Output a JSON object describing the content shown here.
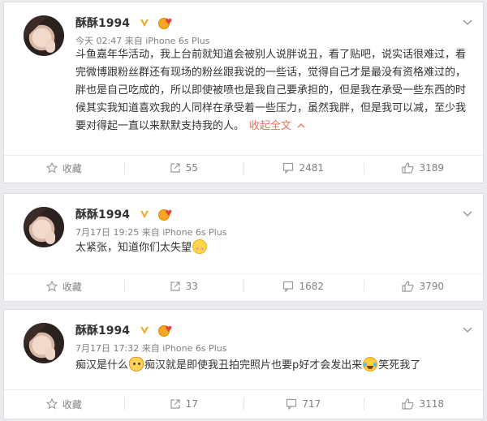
{
  "colors": {
    "background": "#e9ebee",
    "card": "#ffffff",
    "link": "#eb7350",
    "meta": "#808080",
    "verified": "#f5a623"
  },
  "posts": [
    {
      "username": "酥酥1994",
      "time": "今天 02:47",
      "source_prefix": "来自",
      "source": "iPhone 6s Plus",
      "text": "斗鱼嘉年华活动，我上台前就知道会被别人说胖说丑，看了贴吧，说实话很难过，看完微博跟粉丝群还有现场的粉丝跟我说的一些话，觉得自己才是最没有资格难过的，胖也是自己吃成的，所以即使被喷也是我自己要承担的，但是我在承受一些东西的时候其实我知道喜欢我的人同样在承受着一些压力，虽然我胖，但是我可以减，至少我要对得起一直以来默默支持我的人。",
      "collapse_label": "收起全文",
      "collapse_icon": "chevron-up-icon",
      "actions": {
        "favorite": "收藏",
        "repost": "55",
        "comment": "2481",
        "like": "3189"
      }
    },
    {
      "username": "酥酥1994",
      "time": "7月17日 19:25",
      "source_prefix": "来自",
      "source": "iPhone 6s Plus",
      "text": "太紧张，知道你们太失望",
      "emoji_icon": "shy-emoji-icon",
      "actions": {
        "favorite": "收藏",
        "repost": "33",
        "comment": "1682",
        "like": "3790"
      }
    },
    {
      "username": "酥酥1994",
      "time": "7月17日 17:32",
      "source_prefix": "来自",
      "source": "iPhone 6s Plus",
      "text_part1": "痴汉是什么",
      "text_part2": "痴汉就是即使我丑拍完照片也要p好才会发出来",
      "text_part3": "笑死我了",
      "emoji_icons": [
        "cat-emoji-icon",
        "laugh-cry-emoji-icon"
      ],
      "actions": {
        "favorite": "收藏",
        "repost": "17",
        "comment": "717",
        "like": "3118"
      }
    }
  ]
}
